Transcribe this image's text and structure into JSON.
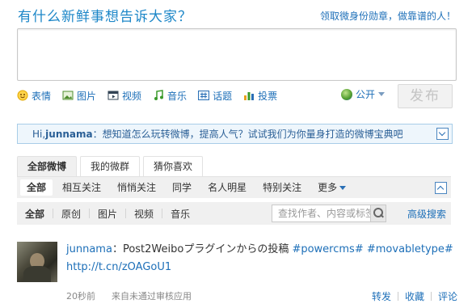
{
  "header": {
    "headline": "有什么新鲜事想告诉大家？",
    "badge_link": "领取微身份勋章，做靠谱的人！"
  },
  "composer": {
    "value": ""
  },
  "toolbar": {
    "items": [
      {
        "label": "表情",
        "icon": "smiley-icon"
      },
      {
        "label": "图片",
        "icon": "image-icon"
      },
      {
        "label": "视频",
        "icon": "video-icon"
      },
      {
        "label": "音乐",
        "icon": "music-icon"
      },
      {
        "label": "话题",
        "icon": "hashtag-icon"
      },
      {
        "label": "投票",
        "icon": "poll-icon"
      }
    ],
    "visibility": "公开",
    "post_label": "发布"
  },
  "tip": {
    "prefix": "Hi,",
    "user": "junnama",
    "text": "：想知道怎么玩转微博，提高人气？试试我们为你量身打造的微博宝典吧"
  },
  "tabs": [
    "全部微博",
    "我的微群",
    "猜你喜欢"
  ],
  "filters": {
    "items": [
      "全部",
      "相互关注",
      "悄悄关注",
      "同学",
      "名人明星",
      "特别关注"
    ],
    "more": "更多"
  },
  "subfilters": {
    "items": [
      "全部",
      "原创",
      "图片",
      "视频",
      "音乐"
    ],
    "search_placeholder": "查找作者、内容或标签",
    "advanced": "高级搜索"
  },
  "feed": [
    {
      "user": "junnama",
      "text": "：Post2Weiboプラグインからの投稿 ",
      "tags": [
        "#powercms#",
        "#movabletype#"
      ],
      "link": "http://t.cn/zOAGoU1",
      "time": "20秒前",
      "source": "来自未通过审核应用",
      "actions": [
        "转发",
        "收藏",
        "评论"
      ]
    }
  ],
  "colors": {
    "link": "#1d6fb8",
    "headline": "#1d87c8",
    "tip_bg": "#eef6fc"
  }
}
